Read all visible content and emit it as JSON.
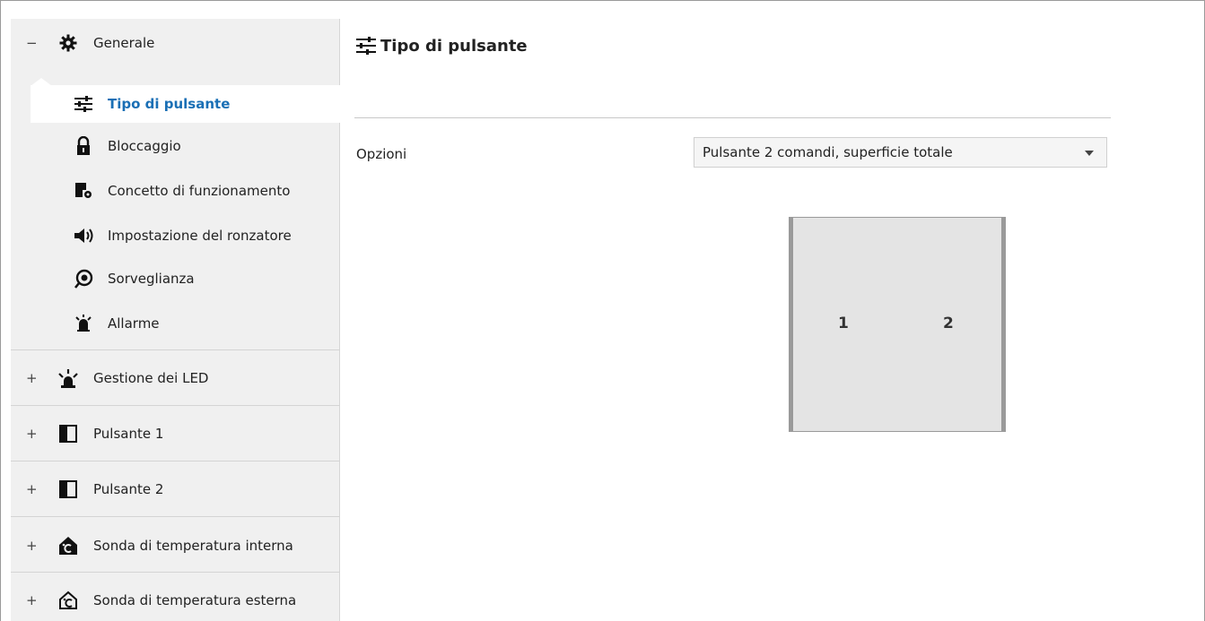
{
  "sidebar": {
    "generale": {
      "expander": "−",
      "label": "Generale",
      "icon": "gear-icon"
    },
    "children": [
      {
        "label": "Tipo di pulsante",
        "icon": "sliders-icon",
        "selected": true
      },
      {
        "label": "Bloccaggio",
        "icon": "lock-icon"
      },
      {
        "label": "Concetto di funzionamento",
        "icon": "operation-concept-icon"
      },
      {
        "label": "Impostazione del ronzatore",
        "icon": "speaker-icon"
      },
      {
        "label": "Sorveglianza",
        "icon": "surveillance-icon"
      },
      {
        "label": "Allarme",
        "icon": "alarm-bell-icon"
      }
    ],
    "groups": [
      {
        "expander": "+",
        "label": "Gestione dei LED",
        "icon": "led-icon"
      },
      {
        "expander": "+",
        "label": "Pulsante 1",
        "icon": "button-panel-icon"
      },
      {
        "expander": "+",
        "label": "Pulsante 2",
        "icon": "button-panel-icon"
      },
      {
        "expander": "+",
        "label": "Sonda di temperatura interna",
        "icon": "house-temperature-icon"
      },
      {
        "expander": "+",
        "label": "Sonda di temperatura esterna",
        "icon": "house-temperature-outline-icon"
      }
    ]
  },
  "main": {
    "title": "Tipo di pulsante",
    "title_icon": "sliders-icon",
    "options_label": "Opzioni",
    "options_value": "Pulsante 2 comandi, superficie totale",
    "device": {
      "rocker_1": "1",
      "rocker_2": "2"
    }
  },
  "colors": {
    "selected_text": "#1a6fb5",
    "sidebar_bg": "#f0f0f0"
  }
}
